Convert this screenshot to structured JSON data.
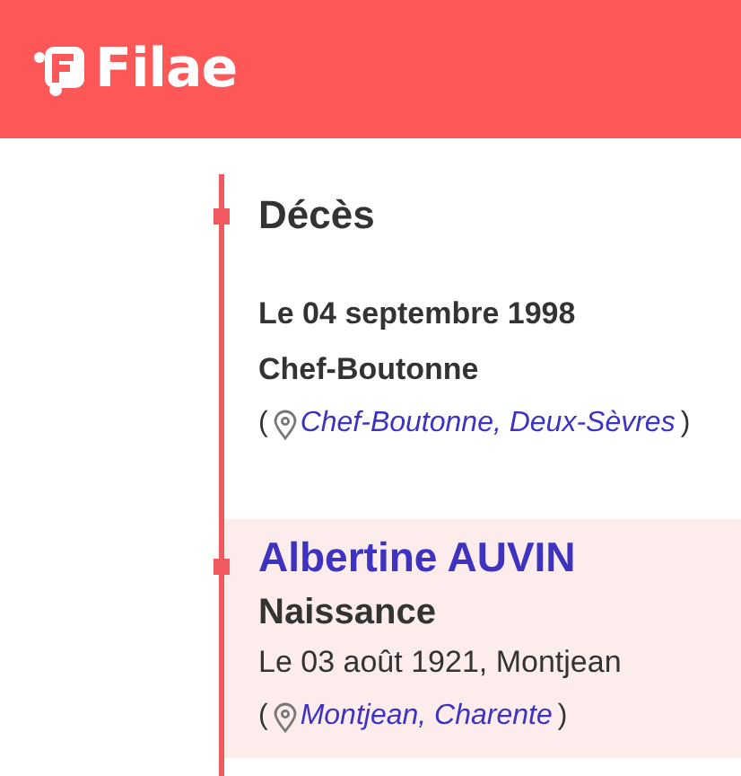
{
  "header": {
    "logo": "Filae"
  },
  "entries": [
    {
      "highlighted": false,
      "title": "Décès",
      "details": [
        {
          "text": "Le 04 septembre 1998",
          "bold": true
        },
        {
          "text": "Chef-Boutonne",
          "bold": true
        }
      ],
      "place": {
        "open": "(",
        "link": "Chef-Boutonne, Deux-Sèvres",
        "close": ")"
      }
    },
    {
      "highlighted": true,
      "name": "Albertine AUVIN",
      "title": "Naissance",
      "details": [
        {
          "text": "Le 03 août 1921, Montjean",
          "bold": false
        }
      ],
      "place": {
        "open": "(",
        "link": "Montjean, Charente",
        "close": ")"
      }
    }
  ]
}
